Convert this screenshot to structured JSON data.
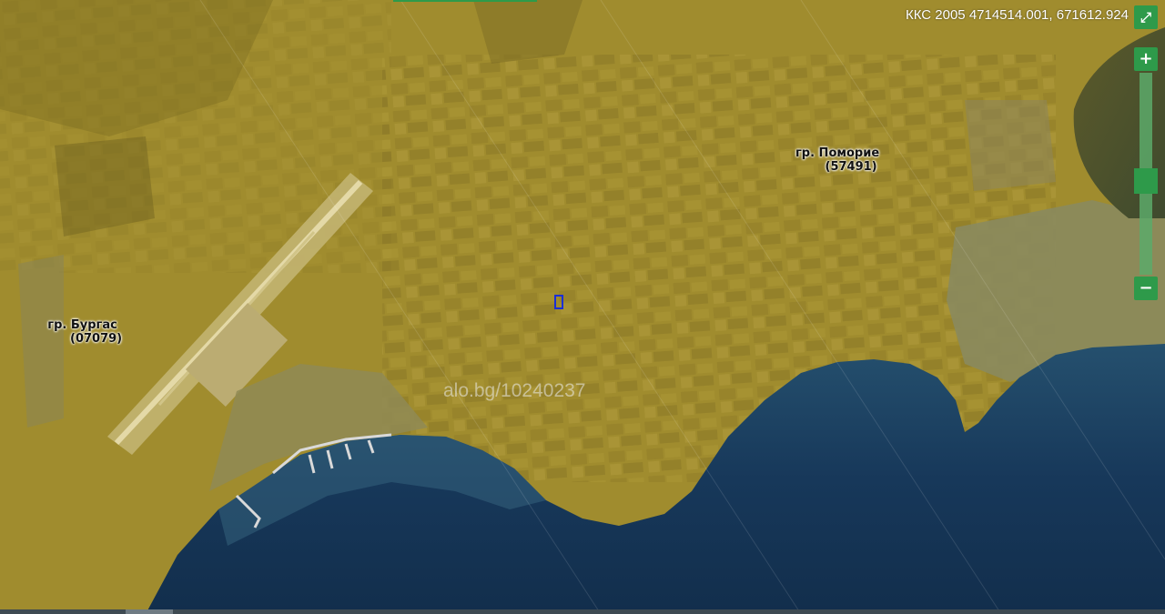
{
  "coords": {
    "text": "ККС 2005 4714514.001, 671612.924"
  },
  "cities": [
    {
      "name": "гр. Поморие",
      "code": "(57491)"
    },
    {
      "name": "гр. Бургас",
      "code": "(07079)"
    }
  ],
  "watermark": "alo.bg/10240237",
  "controls": {
    "fullscreen": "⤢",
    "zoom_in": "+",
    "zoom_out": "−"
  },
  "colors": {
    "land": "#a08c2e",
    "sea": "#17385a",
    "accent": "#2e9a4a",
    "parcel_outline": "#1a2fd6"
  }
}
